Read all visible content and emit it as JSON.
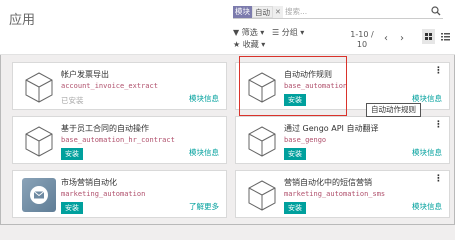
{
  "page": {
    "title": "应用"
  },
  "search": {
    "facet_key": "模块",
    "facet_value": "自动",
    "facet_remove": "✕",
    "placeholder": "搜索..."
  },
  "filters": {
    "filter_label": "筛选",
    "group_label": "分组",
    "fav_label": "收藏"
  },
  "pager": {
    "line1": "1-10 /",
    "line2": "10"
  },
  "cards": [
    {
      "name": "帐户发票导出",
      "tech": "account_invoice_extract",
      "status": "已安装",
      "link": "模块信息"
    },
    {
      "name": "自动动作规则",
      "tech": "base_automation",
      "button": "安装",
      "link": "模块信息"
    },
    {
      "name": "基于员工合同的自动操作",
      "tech": "base_automation_hr_contract",
      "button": "安装",
      "link": "模块信息"
    },
    {
      "name": "通过 Gengo API 自动翻译",
      "tech": "base_gengo",
      "button": "安装",
      "link": "模块信息"
    },
    {
      "name": "市场营销自动化",
      "tech": "marketing_automation",
      "button": "安装",
      "link": "了解更多"
    },
    {
      "name": "营销自动化中的短信营销",
      "tech": "marketing_automation_sms",
      "button": "安装",
      "link": "模块信息"
    }
  ],
  "tooltip": {
    "text": "自动动作规则"
  },
  "colors": {
    "accent": "#00a09d",
    "facet": "#7c7bad",
    "technical_name": "#b0506c",
    "highlight": "#d9332b"
  }
}
